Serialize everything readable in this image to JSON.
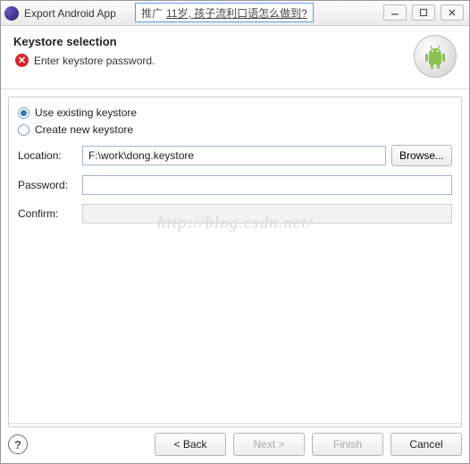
{
  "titlebar": {
    "title": "Export Android App",
    "ad": {
      "prefix": "推广",
      "link": "11岁, 孩子流利口语怎么做到?"
    },
    "min_tip": "Minimize",
    "max_tip": "Maximize",
    "close_tip": "Close"
  },
  "header": {
    "section_title": "Keystore selection",
    "error_message": "Enter keystore password."
  },
  "radios": {
    "use_existing": "Use existing keystore",
    "create_new": "Create new keystore"
  },
  "fields": {
    "location_label": "Location:",
    "location_value": "F:\\work\\dong.keystore",
    "password_label": "Password:",
    "password_value": "",
    "confirm_label": "Confirm:",
    "confirm_value": "",
    "browse_label": "Browse..."
  },
  "watermark": "http://blog.csdn.net/",
  "footer": {
    "help": "?",
    "back": "< Back",
    "next": "Next >",
    "finish": "Finish",
    "cancel": "Cancel"
  }
}
